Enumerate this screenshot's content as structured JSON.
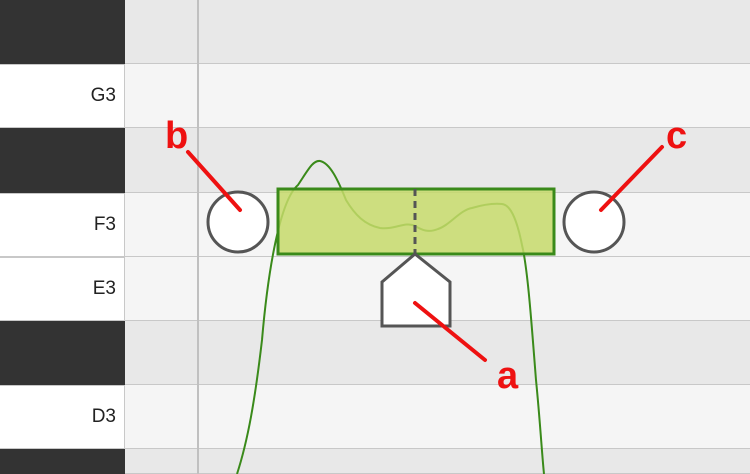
{
  "piano_roll": {
    "keys": [
      {
        "label": "",
        "black": true
      },
      {
        "label": "G3",
        "black": false
      },
      {
        "label": "",
        "black": true
      },
      {
        "label": "F3",
        "black": false
      },
      {
        "label": "E3",
        "black": false
      },
      {
        "label": "",
        "black": true
      },
      {
        "label": "D3",
        "black": false
      },
      {
        "label": "",
        "black": true
      }
    ]
  },
  "note": {
    "color": "#c5d96a",
    "border_color": "#3a8a1a",
    "pitch_curve_color": "#3a8a1a"
  },
  "callouts": {
    "color": "#ee1111",
    "a": "a",
    "b": "b",
    "c": "c"
  }
}
